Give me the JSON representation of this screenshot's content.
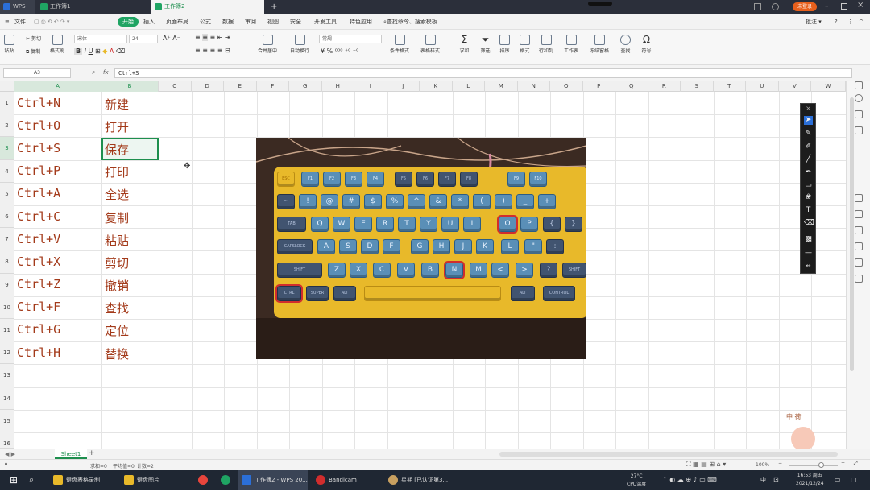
{
  "titlebar": {
    "app_name": "WPS",
    "tabs": [
      {
        "label": "工作簿1"
      },
      {
        "label": "工作簿2"
      }
    ],
    "user_badge": "未登录",
    "new_tab": "+"
  },
  "menubar": {
    "file": "文件",
    "items": [
      "开始",
      "插入",
      "页面布局",
      "公式",
      "数据",
      "审阅",
      "视图",
      "安全",
      "开发工具",
      "特色应用"
    ],
    "search": "查找命令、搜索模板",
    "comment": "批注"
  },
  "ribbon": {
    "paste": "粘贴",
    "cut": "剪切",
    "copy": "复制",
    "format_painter": "格式刷",
    "font_name": "宋体",
    "font_size": "24",
    "number_format": "常规",
    "merge": "合并居中",
    "wrap": "自动换行",
    "cond_format": "条件格式",
    "table_style": "表格样式",
    "sum": "求和",
    "filter": "筛选",
    "sort": "排序",
    "format": "格式",
    "rowcol": "行和列",
    "worksheet": "工作表",
    "freeze": "冻结窗格",
    "find": "查找",
    "symbol": "符号"
  },
  "formulabar": {
    "cell_ref": "A3",
    "fx": "fx",
    "content": "Ctrl+S"
  },
  "columns": [
    "A",
    "B",
    "C",
    "D",
    "E",
    "F",
    "G",
    "H",
    "I",
    "J",
    "K",
    "L",
    "M",
    "N",
    "O",
    "P",
    "Q",
    "R",
    "S",
    "T",
    "U",
    "V",
    "W"
  ],
  "rows": [
    {
      "num": "1",
      "a": "Ctrl+N",
      "b": "新建"
    },
    {
      "num": "2",
      "a": "Ctrl+O",
      "b": "打开"
    },
    {
      "num": "3",
      "a": "Ctrl+S",
      "b": "保存"
    },
    {
      "num": "4",
      "a": "Ctrl+P",
      "b": "打印"
    },
    {
      "num": "5",
      "a": "Ctrl+A",
      "b": "全选"
    },
    {
      "num": "6",
      "a": "Ctrl+C",
      "b": "复制"
    },
    {
      "num": "7",
      "a": "Ctrl+V",
      "b": "粘贴"
    },
    {
      "num": "8",
      "a": "Ctrl+X",
      "b": "剪切"
    },
    {
      "num": "9",
      "a": "Ctrl+Z",
      "b": "撤销"
    },
    {
      "num": "10",
      "a": "Ctrl+F",
      "b": "查找"
    },
    {
      "num": "11",
      "a": "Ctrl+G",
      "b": "定位"
    },
    {
      "num": "12",
      "a": "Ctrl+H",
      "b": "替换"
    },
    {
      "num": "13",
      "a": "",
      "b": ""
    },
    {
      "num": "14",
      "a": "",
      "b": ""
    },
    {
      "num": "15",
      "a": "",
      "b": ""
    },
    {
      "num": "16",
      "a": "",
      "b": ""
    }
  ],
  "keyboard_photo": {
    "function_row": [
      "ESC",
      "F1",
      "F2",
      "F3",
      "F4",
      "F5",
      "F6",
      "F7",
      "F8",
      "F9",
      "F10"
    ],
    "number_row": [
      "~",
      "!",
      "@",
      "#",
      "$",
      "%",
      "^",
      "&",
      "*",
      "(",
      ")",
      "_",
      "+"
    ],
    "qwerty_row": [
      "TAB",
      "Q",
      "W",
      "E",
      "R",
      "T",
      "Y",
      "U",
      "I",
      "O",
      "P",
      "{",
      "}"
    ],
    "home_row": [
      "CAPSLOCK",
      "A",
      "S",
      "D",
      "F",
      "G",
      "H",
      "J",
      "K",
      "L",
      "\"",
      ":"
    ],
    "shift_row": [
      "SHIFT",
      "Z",
      "X",
      "C",
      "V",
      "B",
      "N",
      "M",
      "<",
      ">",
      "?",
      "SHIFT"
    ],
    "bottom_row": [
      "CTRL",
      "SUPER",
      "ALT",
      "ALT",
      "CONTROL"
    ],
    "highlighted": [
      "CTRL",
      "O",
      "N"
    ]
  },
  "watermark": {
    "chars": "中 荷"
  },
  "sheetbar": {
    "tab": "Sheet1",
    "add": "+"
  },
  "statusbar": {
    "sum": "求和=0",
    "avg": "平均值=0",
    "count": "计数=2",
    "zoom": "100%"
  },
  "taskbar": {
    "apps": [
      {
        "label": "键盘表格录制"
      },
      {
        "label": "键盘图片"
      },
      {
        "label": ""
      },
      {
        "label": ""
      },
      {
        "label": "工作簿2 - WPS 20..."
      },
      {
        "label": "Bandicam"
      },
      {
        "label": "星期 [已认证第3..."
      }
    ],
    "weather_temp": "27°C",
    "weather_desc": "CPU温度",
    "ime": "中",
    "time": "16:53 周五",
    "date": "2021/12/24"
  },
  "colors": {
    "accent": "#1fa463",
    "cell_text": "#a33a1a",
    "selection": "#1e8f4e"
  }
}
